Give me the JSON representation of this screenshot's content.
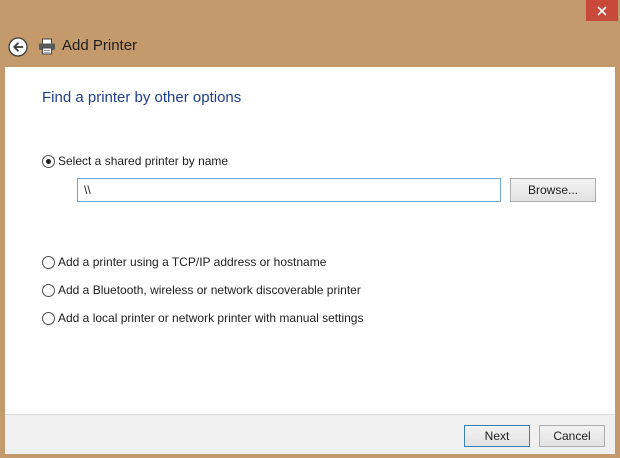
{
  "window": {
    "title": "Add Printer"
  },
  "icons": {
    "back": "back-arrow-icon",
    "printer": "printer-icon",
    "close": "close-icon"
  },
  "colors": {
    "window_frame": "#c49a6c",
    "close_button": "#c8483a",
    "heading": "#1f3f8e",
    "input_border": "#6aa8d8"
  },
  "main": {
    "heading": "Find a printer by other options",
    "options": [
      {
        "label": "Select a shared printer by name",
        "selected": true
      },
      {
        "label": "Add a printer using a TCP/IP address or hostname",
        "selected": false
      },
      {
        "label": "Add a Bluetooth, wireless or network discoverable printer",
        "selected": false
      },
      {
        "label": "Add a local printer or network printer with manual settings",
        "selected": false
      }
    ],
    "shared_name_input": {
      "value": "\\\\"
    },
    "browse_label": "Browse..."
  },
  "footer": {
    "next_label": "Next",
    "cancel_label": "Cancel"
  }
}
